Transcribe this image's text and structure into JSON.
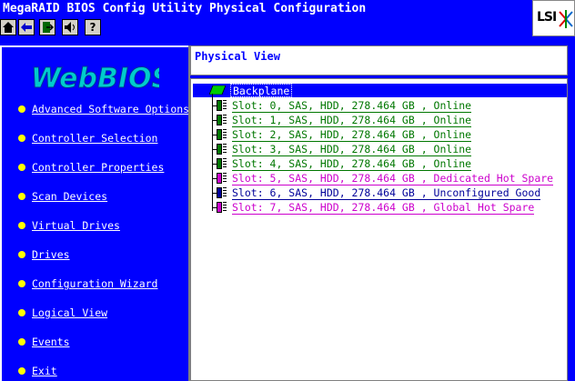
{
  "title": "MegaRAID BIOS Config Utility  Physical Configuration",
  "logo": {
    "text": "LSI"
  },
  "toolbar": {
    "buttons": [
      {
        "name": "home-icon"
      },
      {
        "name": "back-arrow-icon"
      },
      {
        "name": "exit-icon"
      },
      {
        "name": "sound-icon"
      },
      {
        "name": "help-icon",
        "glyph": "?"
      }
    ]
  },
  "sidebar": {
    "logo": "WebBIOS",
    "items": [
      {
        "label": "Advanced Software Options"
      },
      {
        "label": "Controller Selection"
      },
      {
        "label": "Controller Properties"
      },
      {
        "label": "Scan Devices"
      },
      {
        "label": "Virtual Drives"
      },
      {
        "label": "Drives"
      },
      {
        "label": "Configuration Wizard"
      },
      {
        "label": "Logical View"
      },
      {
        "label": "Events"
      },
      {
        "label": "Exit"
      }
    ]
  },
  "main": {
    "header": "Physical View",
    "backplane": "Backplane",
    "slots": [
      {
        "label": "Slot: 0, SAS, HDD, 278.464 GB , Online",
        "color": "#007700"
      },
      {
        "label": "Slot: 1, SAS, HDD, 278.464 GB , Online",
        "color": "#007700"
      },
      {
        "label": "Slot: 2, SAS, HDD, 278.464 GB , Online",
        "color": "#007700"
      },
      {
        "label": "Slot: 3, SAS, HDD, 278.464 GB , Online",
        "color": "#007700"
      },
      {
        "label": "Slot: 4, SAS, HDD, 278.464 GB , Online",
        "color": "#007700"
      },
      {
        "label": "Slot: 5, SAS, HDD, 278.464 GB , Dedicated Hot Spare",
        "color": "#cc00cc"
      },
      {
        "label": "Slot: 6, SAS, HDD, 278.464 GB , Unconfigured Good",
        "color": "#000099"
      },
      {
        "label": "Slot: 7, SAS, HDD, 278.464 GB , Global Hot Spare",
        "color": "#cc00cc"
      }
    ]
  },
  "colors": {
    "background": "#0000ff",
    "online": "#007700",
    "hot_spare": "#cc00cc",
    "unconfigured": "#000099",
    "bullet": "#ffff00"
  }
}
